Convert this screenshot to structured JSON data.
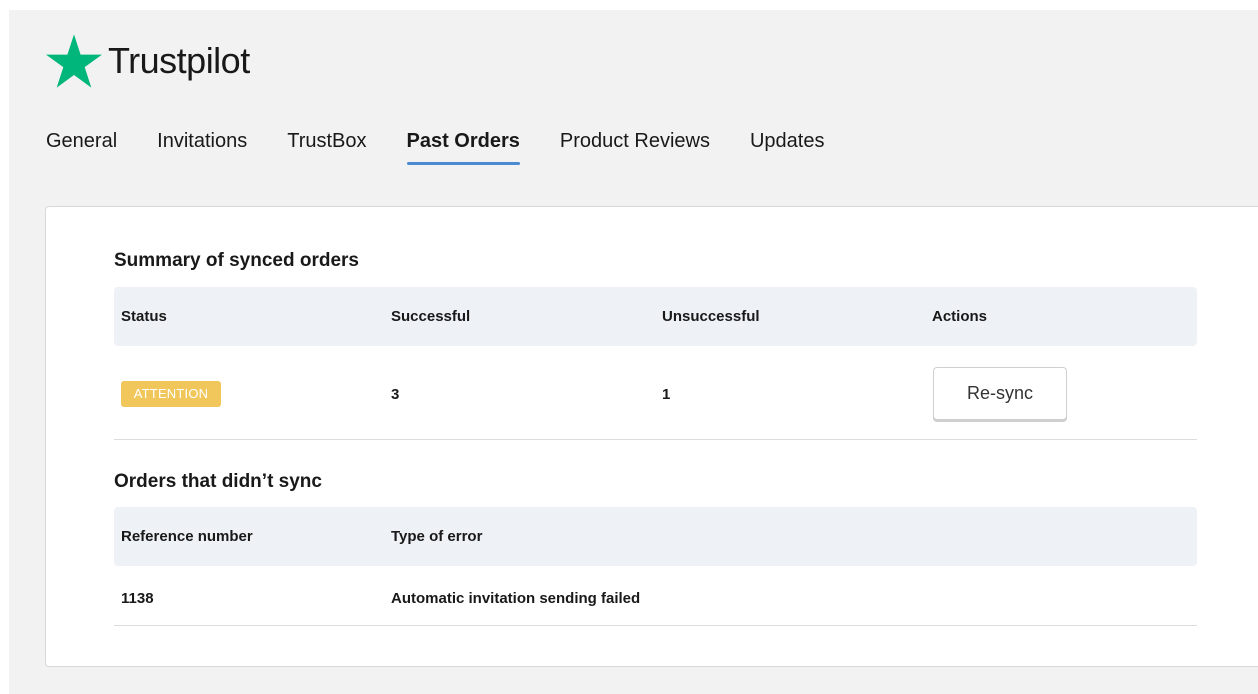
{
  "brand": {
    "name": "Trustpilot",
    "star_color": "#00b67a",
    "star_icon": "star-icon"
  },
  "tabs": [
    {
      "label": "General",
      "active": false
    },
    {
      "label": "Invitations",
      "active": false
    },
    {
      "label": "TrustBox",
      "active": false
    },
    {
      "label": "Past Orders",
      "active": true
    },
    {
      "label": "Product Reviews",
      "active": false
    },
    {
      "label": "Updates",
      "active": false
    }
  ],
  "summary": {
    "title": "Summary of synced orders",
    "headers": {
      "status": "Status",
      "successful": "Successful",
      "unsuccessful": "Unsuccessful",
      "actions": "Actions"
    },
    "row": {
      "status": "ATTENTION",
      "status_color": "#f1c75c",
      "successful": "3",
      "unsuccessful": "1",
      "action_label": "Re-sync"
    }
  },
  "failed": {
    "title": "Orders that didn’t sync",
    "headers": {
      "reference": "Reference number",
      "error": "Type of error"
    },
    "rows": [
      {
        "reference": "1138",
        "error": "Automatic invitation sending failed"
      }
    ]
  },
  "colors": {
    "active_tab_underline": "#4a8bd1",
    "table_header_bg": "#eef1f5"
  }
}
